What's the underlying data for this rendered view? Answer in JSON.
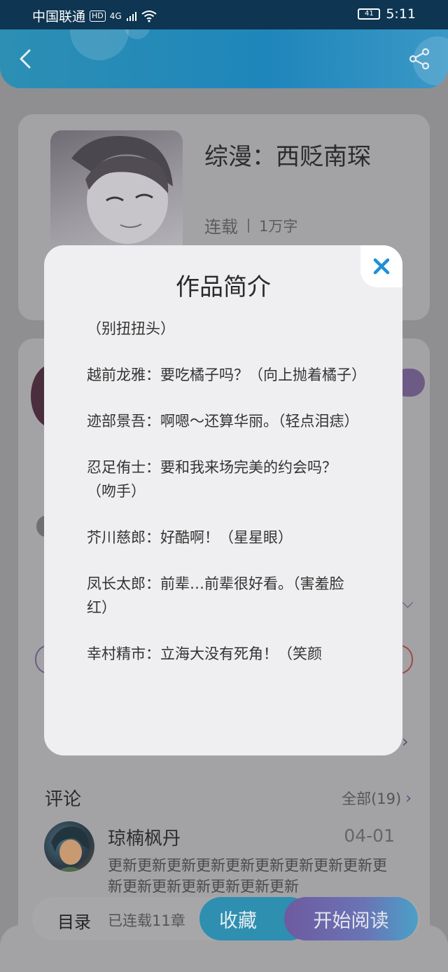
{
  "status_bar": {
    "carrier": "中国联通",
    "hd": "HD",
    "network": "4G",
    "battery": "41",
    "time": "5:11"
  },
  "book": {
    "title": "综漫：西贬南琛",
    "status": "连载",
    "word_count": "1万字"
  },
  "comments": {
    "heading": "评论",
    "all_label": "全部(19)",
    "items": [
      {
        "user": "琼楠枫丹",
        "date": "04-01",
        "text": "更新更新更新更新更新更新更新更新更新更新更新更新更新更新更新更新"
      }
    ]
  },
  "bottom_bar": {
    "toc_label": "目录",
    "serial_info": "已连载11章",
    "favorite_label": "收藏",
    "read_label": "开始阅读"
  },
  "modal": {
    "title": "作品简介",
    "paragraphs": [
      "（别扭扭头）",
      "越前龙雅：要吃橘子吗？（向上抛着橘子）",
      "迹部景吾：啊嗯～还算华丽。（轻点泪痣）",
      "忍足侑士：要和我来场完美的约会吗？（吻手）",
      "芥川慈郎：好酷啊！（星星眼）",
      "凤长太郎：前辈…前辈很好看。（害羞脸红）",
      "幸村精市：立海大没有死角！（笑颜"
    ]
  },
  "colors": {
    "header": "#1f86bb",
    "favorite": "#2e8fb0",
    "read_start": "#6e5aa0",
    "close_icon": "#1f8fd6"
  },
  "icons": [
    "back-icon",
    "share-icon",
    "close-icon",
    "chevron-right-icon",
    "wifi-icon",
    "signal-icon",
    "battery-icon"
  ]
}
